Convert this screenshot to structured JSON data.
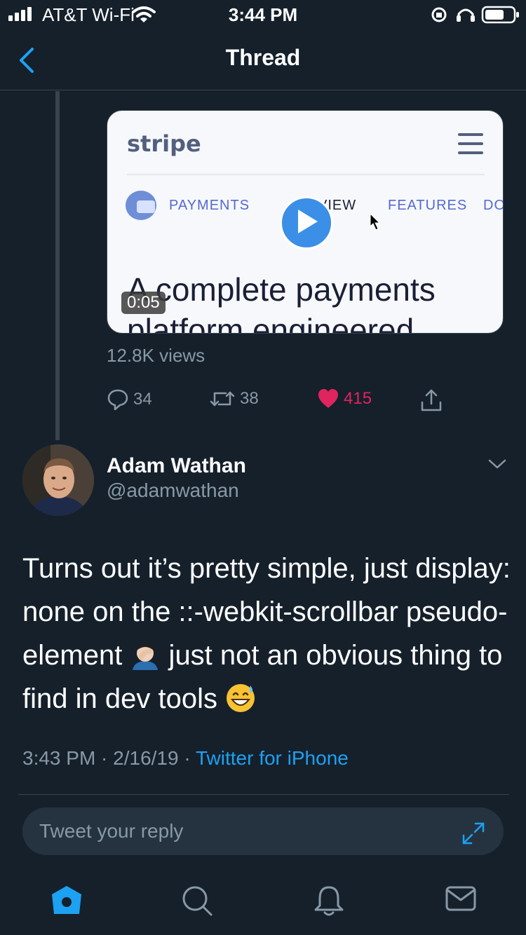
{
  "status_bar": {
    "carrier": "AT&T Wi-Fi",
    "time": "3:44 PM"
  },
  "nav": {
    "title": "Thread"
  },
  "previous_tweet": {
    "video": {
      "brand": "stripe",
      "menu_items": [
        "PAYMENTS",
        "VIEW",
        "FEATURES",
        "DO"
      ],
      "headline": "A complete payments",
      "headline_line2": "platform engineered",
      "duration": "0:05"
    },
    "views": "12.8K views",
    "actions": {
      "replies": "34",
      "retweets": "38",
      "likes": "415"
    }
  },
  "tweet": {
    "author_name": "Adam Wathan",
    "author_handle": "@adamwathan",
    "body_part1": "Turns out it’s pretty simple, just display: none on the ::-webkit-scrollbar pseudo-element",
    "body_part2": " just not an obvious thing to find in dev tools",
    "timestamp": "3:43 PM · 2/16/19 · ",
    "source": "Twitter for iPhone"
  },
  "reply": {
    "placeholder": "Tweet your reply"
  },
  "colors": {
    "background": "#15202b",
    "accent": "#1da1f2",
    "like": "#e0245e",
    "muted": "#8899a6"
  },
  "icons": [
    "back-chevron-icon",
    "play-icon",
    "reply-icon",
    "retweet-icon",
    "heart-icon",
    "share-icon",
    "chevron-down-icon",
    "expand-icon",
    "home-icon",
    "search-icon",
    "notifications-icon",
    "messages-icon"
  ]
}
